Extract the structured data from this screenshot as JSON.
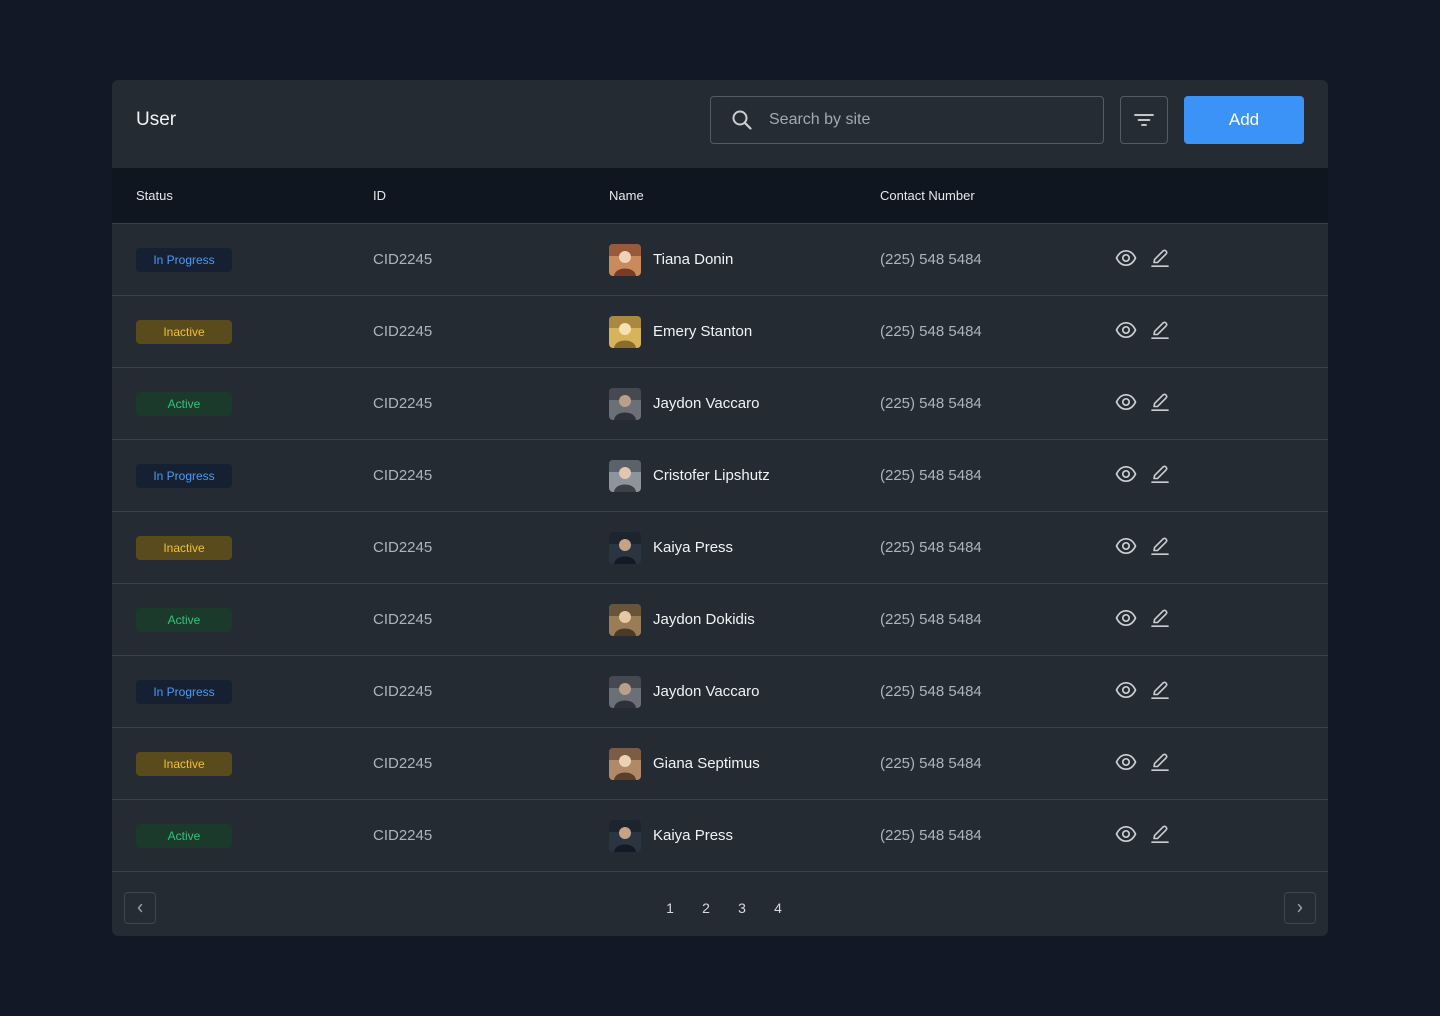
{
  "header": {
    "title": "User",
    "search_placeholder": "Search by site",
    "add_label": "Add"
  },
  "table": {
    "columns": [
      "Status",
      "ID",
      "Name",
      "Contact Number"
    ],
    "rows": [
      {
        "status": "In Progress",
        "status_kind": "progress",
        "id": "CID2245",
        "name": "Tiana Donin",
        "contact": "(225) 548 5484"
      },
      {
        "status": "Inactive",
        "status_kind": "inactive",
        "id": "CID2245",
        "name": "Emery Stanton",
        "contact": "(225) 548 5484"
      },
      {
        "status": "Active",
        "status_kind": "active",
        "id": "CID2245",
        "name": "Jaydon Vaccaro",
        "contact": "(225) 548 5484"
      },
      {
        "status": "In Progress",
        "status_kind": "progress",
        "id": "CID2245",
        "name": "Cristofer Lipshutz",
        "contact": "(225) 548 5484"
      },
      {
        "status": "Inactive",
        "status_kind": "inactive",
        "id": "CID2245",
        "name": "Kaiya Press",
        "contact": "(225) 548 5484"
      },
      {
        "status": "Active",
        "status_kind": "active",
        "id": "CID2245",
        "name": "Jaydon Dokidis",
        "contact": "(225) 548 5484"
      },
      {
        "status": "In Progress",
        "status_kind": "progress",
        "id": "CID2245",
        "name": "Jaydon Vaccaro",
        "contact": "(225) 548 5484"
      },
      {
        "status": "Inactive",
        "status_kind": "inactive",
        "id": "CID2245",
        "name": "Giana Septimus",
        "contact": "(225) 548 5484"
      },
      {
        "status": "Active",
        "status_kind": "active",
        "id": "CID2245",
        "name": "Kaiya Press",
        "contact": "(225) 548 5484"
      }
    ]
  },
  "pagination": {
    "pages": [
      "1",
      "2",
      "3",
      "4"
    ]
  },
  "icons": {
    "search": "search-icon",
    "filter": "filter-icon",
    "view": "eye-icon",
    "edit": "pencil-icon",
    "prev": "chevron-left-icon",
    "next": "chevron-right-icon"
  },
  "colors": {
    "page_bg": "#121826",
    "card_bg": "#252b33",
    "accent": "#3b93f7",
    "status_progress": "#4a9bf7",
    "status_inactive": "#f2c12e",
    "status_active": "#2ec27e"
  }
}
